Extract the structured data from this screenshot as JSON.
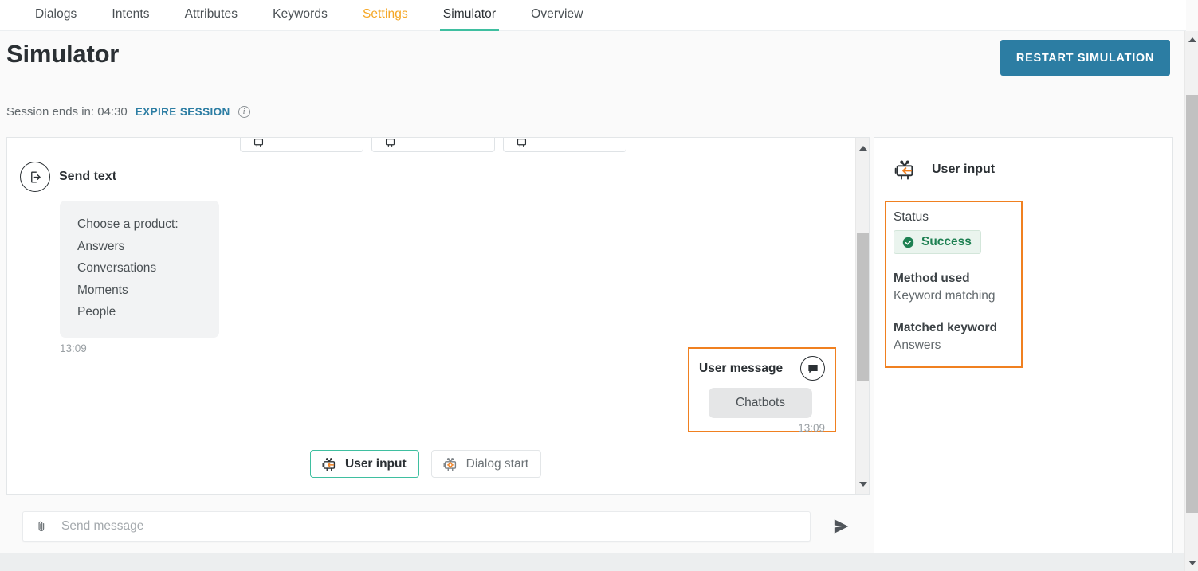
{
  "nav": {
    "tabs": [
      {
        "label": "Dialogs",
        "state": "normal"
      },
      {
        "label": "Intents",
        "state": "normal"
      },
      {
        "label": "Attributes",
        "state": "normal"
      },
      {
        "label": "Keywords",
        "state": "normal"
      },
      {
        "label": "Settings",
        "state": "highlight"
      },
      {
        "label": "Simulator",
        "state": "active"
      },
      {
        "label": "Overview",
        "state": "normal"
      }
    ]
  },
  "header": {
    "title": "Simulator",
    "restart_label": "RESTART SIMULATION",
    "session_text": "Session ends in: 04:30",
    "expire_label": "EXPIRE SESSION",
    "info_glyph": "i"
  },
  "chat": {
    "cut_chips": [
      {
        "label": ""
      },
      {
        "label": ""
      },
      {
        "label": ""
      }
    ],
    "bot_node": {
      "icon": "send-text-icon",
      "title": "Send text",
      "lines": [
        "Choose a product:",
        "Answers",
        "Conversations",
        "Moments",
        "People"
      ],
      "time": "13:09"
    },
    "user_node": {
      "title": "User message",
      "icon": "chat-bubble-icon",
      "text": "Chatbots",
      "time": "13:09"
    },
    "chips": [
      {
        "label": "User input",
        "icon": "robot-user-input-icon",
        "selected": true
      },
      {
        "label": "Dialog start",
        "icon": "robot-dialog-start-icon",
        "selected": false
      }
    ]
  },
  "composer": {
    "attach_icon": "paperclip-icon",
    "placeholder": "Send message",
    "value": "",
    "send_icon": "send-icon"
  },
  "details": {
    "icon": "robot-user-input-icon",
    "title": "User input",
    "status_label": "Status",
    "status_value": "Success",
    "status_icon": "check-circle-icon",
    "method_label": "Method used",
    "method_value": "Keyword matching",
    "keyword_label": "Matched keyword",
    "keyword_value": "Answers"
  },
  "colors": {
    "accent_teal": "#3fbfa0",
    "accent_orange": "#f08020",
    "settings_amber": "#f5a623",
    "button_blue": "#2c7da3",
    "success_green": "#1e8052",
    "link_blue": "#2c7da3"
  }
}
